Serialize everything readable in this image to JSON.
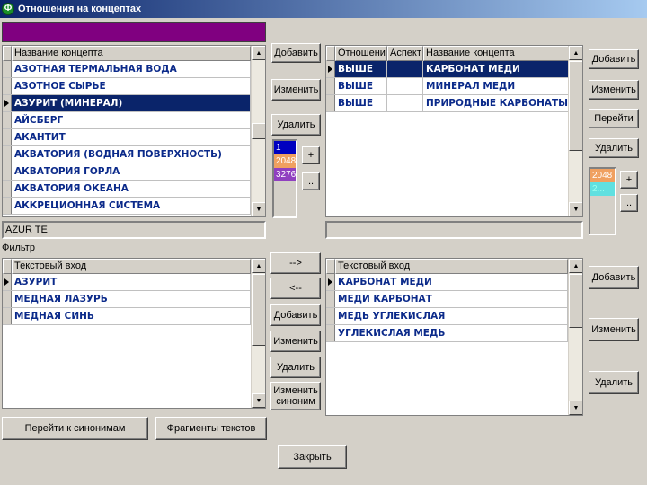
{
  "window": {
    "title": "Отношения на концептах",
    "app_icon": "Ф"
  },
  "left_concepts": {
    "header": "Название концепта",
    "rows": [
      "АЗОТНАЯ ТЕРМАЛЬНАЯ ВОДА",
      "АЗОТНОЕ СЫРЬЕ",
      "АЗУРИТ (МИНЕРАЛ)",
      "АЙСБЕРГ",
      "АКАНТИТ",
      "АКВАТОРИЯ (ВОДНАЯ ПОВЕРХНОСТЬ)",
      "АКВАТОРИЯ ГОРЛА",
      "АКВАТОРИЯ ОКЕАНА",
      "АККРЕЦИОННАЯ СИСТЕМА"
    ],
    "selected_index": 2,
    "translation": "AZUR TE"
  },
  "left_buttons": {
    "add": "Добавить",
    "edit": "Изменить",
    "delete": "Удалить",
    "plus": "+",
    "dots": ".."
  },
  "color_list_left": {
    "items": [
      "1",
      "2048",
      "3276"
    ],
    "colors": [
      "#0000c0",
      "#f0a060",
      "#9040c0"
    ]
  },
  "relations": {
    "headers": [
      "Отношение",
      "Аспект",
      "Название концепта"
    ],
    "rows": [
      {
        "relation": "ВЫШЕ",
        "aspect": "",
        "concept": "КАРБОНАТ МЕДИ"
      },
      {
        "relation": "ВЫШЕ",
        "aspect": "",
        "concept": "МИНЕРАЛ МЕДИ"
      },
      {
        "relation": "ВЫШЕ",
        "aspect": "",
        "concept": "ПРИРОДНЫЕ КАРБОНАТЫ"
      }
    ],
    "selected_index": 0
  },
  "right_buttons": {
    "add": "Добавить",
    "edit": "Изменить",
    "goto": "Перейти",
    "delete": "Удалить",
    "plus": "+",
    "dots": ".."
  },
  "color_list_right": {
    "items": [
      "2048",
      "2..."
    ],
    "colors": [
      "#f0a060",
      "#60e0e0"
    ]
  },
  "filter_label": "Фильтр",
  "left_text": {
    "header": "Текстовый вход",
    "rows": [
      "АЗУРИТ",
      "МЕДНАЯ ЛАЗУРЬ",
      "МЕДНАЯ СИНЬ"
    ],
    "current_index": 0
  },
  "mid_buttons": {
    "right": "-->",
    "left": "<--",
    "add": "Добавить",
    "edit": "Изменить",
    "delete": "Удалить",
    "edit_syn_1": "Изменить",
    "edit_syn_2": "синоним"
  },
  "right_text": {
    "header": "Текстовый вход",
    "rows": [
      "КАРБОНАТ МЕДИ",
      "МЕДИ КАРБОНАТ",
      "МЕДЬ УГЛЕКИСЛАЯ",
      "УГЛЕКИСЛАЯ МЕДЬ"
    ],
    "current_index": 0
  },
  "right_text_buttons": {
    "add": "Добавить",
    "edit": "Изменить",
    "delete": "Удалить"
  },
  "bottom_buttons": {
    "goto_synonyms": "Перейти к синонимам",
    "fragments": "Фрагменты текстов",
    "close": "Закрыть"
  },
  "accent": {
    "purple_bar": "#800080",
    "selection": "#0a246a"
  }
}
